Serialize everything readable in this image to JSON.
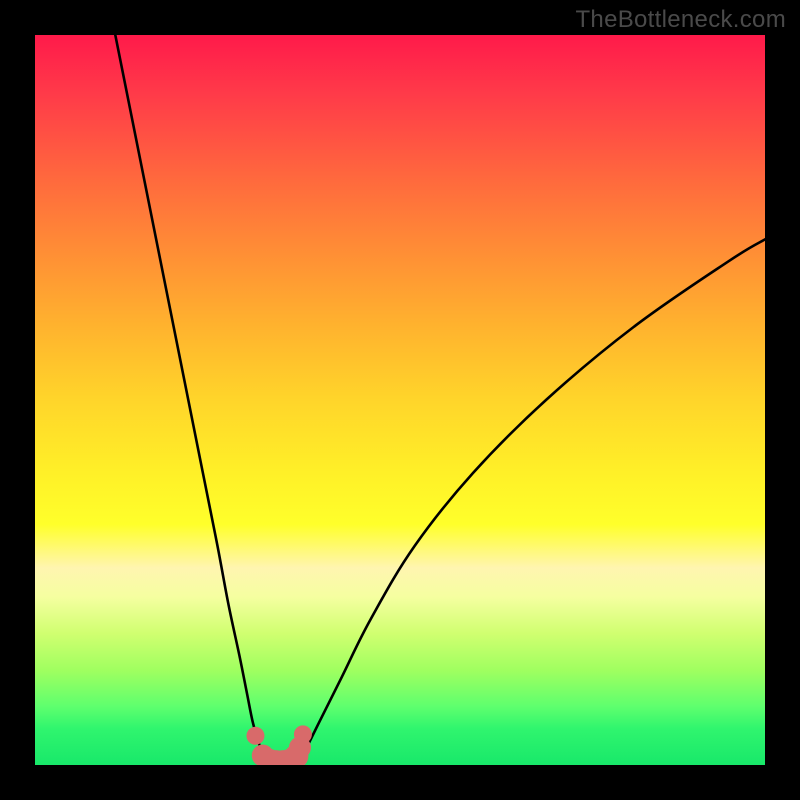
{
  "watermark": "TheBottleneck.com",
  "chart_data": {
    "type": "line",
    "title": "",
    "xlabel": "",
    "ylabel": "",
    "xlim": [
      0,
      100
    ],
    "ylim": [
      0,
      100
    ],
    "series": [
      {
        "name": "left-curve",
        "x": [
          11,
          15,
          18,
          21,
          23,
          25,
          26.5,
          28,
          29,
          29.8,
          30.5,
          31.2,
          31.8
        ],
        "y": [
          100,
          80,
          65,
          50,
          40,
          30,
          22,
          15,
          10,
          6,
          3.5,
          1.5,
          0.5
        ]
      },
      {
        "name": "right-curve",
        "x": [
          36,
          37,
          39,
          42,
          46,
          52,
          60,
          70,
          82,
          95,
          100
        ],
        "y": [
          0.5,
          2,
          6,
          12,
          20,
          30,
          40,
          50,
          60,
          69,
          72
        ]
      },
      {
        "name": "highlight-dots",
        "x": [
          30.2,
          31.2,
          32.0,
          33.0,
          34.0,
          35.0,
          35.8,
          36.3,
          36.7
        ],
        "y": [
          4.0,
          1.3,
          0.6,
          0.4,
          0.4,
          0.6,
          1.2,
          2.4,
          4.2
        ]
      }
    ],
    "colors": {
      "curve": "#000000",
      "highlight": "#d86a6a"
    }
  }
}
